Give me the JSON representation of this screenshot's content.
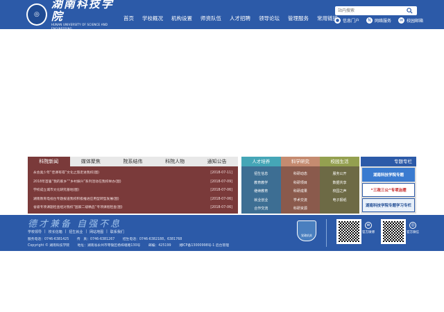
{
  "header": {
    "logo_mark": "湖南科技学院",
    "logo_cn": "湖南科技学院",
    "logo_en": "HUNAN UNIVERSITY OF SCIENCE AND ENGINEERING",
    "nav": [
      "首页",
      "学校概况",
      "机构设置",
      "师资队伍",
      "人才招聘",
      "领导论坛",
      "管理服务",
      "常用链接"
    ],
    "search_placeholder": "站内搜索",
    "quick_links": [
      "信息门户",
      "网络服务",
      "校园邮箱"
    ]
  },
  "news": {
    "tabs": [
      "科院新闻",
      "媒体聚焦",
      "院系结伟",
      "科院人物",
      "通知公告"
    ],
    "items": [
      {
        "title": "永会奥少年“佳课有得”文化之旅走进我校(图)",
        "date": "[2018-07-11]"
      },
      {
        "title": "2018年首届“我的家乡”“乡村振兴”系列活动在我校举办(图)",
        "date": "[2018-07-09]"
      },
      {
        "title": "学校成立城市文化研究基地(图)",
        "date": "[2018-07-06]"
      },
      {
        "title": "湖南教育电视台专题报道我校积极推进应用型转型发展(图)",
        "date": "[2018-07-06]"
      },
      {
        "title": "省级专项课题检查组对我校“国家二级精品”专项课程检查(图)",
        "date": "[2018-07-06]"
      }
    ]
  },
  "columns": [
    {
      "head": "人才培养",
      "links": [
        "招生信息",
        "教育教学",
        "继续教育",
        "就业创业",
        "合作交流"
      ]
    },
    {
      "head": "科学研究",
      "links": [
        "科研动态",
        "科研项目",
        "科研成果",
        "学术交流",
        "科研资源"
      ]
    },
    {
      "head": "校园生活",
      "links": [
        "服务公开",
        "数据共享",
        "校园之声",
        "电子报纸"
      ]
    }
  ],
  "topics": {
    "head": "专题专栏",
    "items": [
      "湖南科技学院专题",
      "“三政三公”专项治理",
      "湖南科技学院专题学习专栏"
    ]
  },
  "footer": {
    "slogan": "德才兼备  自强不息",
    "links": [
      "学校领导",
      "校长信箱",
      "招生就业",
      "网站地图",
      "联系我们"
    ],
    "sep": "|",
    "info1": [
      "服务电话：0746-6381425",
      "传　真：0746-6381267",
      "招生电话：0746-6382188，6381768"
    ],
    "info2": [
      "Copyright © 湖南科技学院",
      "地址：湖南省永州市零陵区杨梓塘路130号",
      "邮编：425199",
      "湘ICP备13000998号-1 后台管理"
    ],
    "badge": "党政机关",
    "social": [
      "官方微博",
      "官方微信"
    ]
  }
}
